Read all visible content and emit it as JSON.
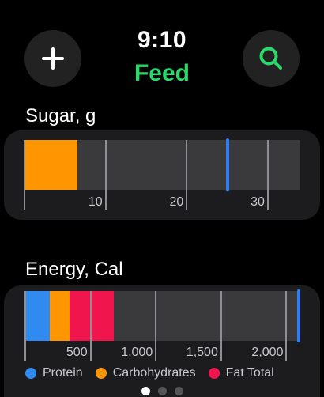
{
  "status": {
    "time": "9:10"
  },
  "screen_title": "Feed",
  "accent_color": "#2bd96b",
  "buttons": {
    "add_icon": "plus-icon",
    "search_icon": "search-icon"
  },
  "sugar": {
    "label": "Sugar, g",
    "ticks": [
      "10",
      "20",
      "30"
    ],
    "scale_max": 34,
    "carbohydrates_value": 6.5,
    "goal_value": 25
  },
  "energy": {
    "label": "Energy, Cal",
    "ticks": [
      "500",
      "1,000",
      "1,500",
      "2,000"
    ],
    "scale_max": 2100,
    "protein_value": 190,
    "carbohydrates_value": 150,
    "fat_value": 340,
    "goal_value": 2100
  },
  "legend": [
    {
      "label": "Protein",
      "color": "#2f8bf0"
    },
    {
      "label": "Carbohydrates",
      "color": "#ff9500"
    },
    {
      "label": "Fat Total",
      "color": "#f0164d"
    }
  ],
  "pager": {
    "pages": 3,
    "active": 0
  }
}
